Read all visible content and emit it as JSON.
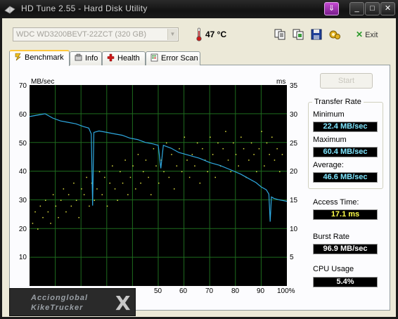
{
  "window": {
    "title": "HD Tune 2.55 - Hard Disk Utility",
    "buttons": {
      "extra": "⇓",
      "minimize": "_",
      "maximize": "□",
      "close": "✕"
    }
  },
  "toolbar": {
    "drive": "WDC WD3200BEVT-22ZCT (320 GB)",
    "temperature": "47 °C",
    "exit_label": "Exit",
    "tools": [
      "copy-text-icon",
      "copy-image-icon",
      "save-icon",
      "options-icon"
    ]
  },
  "tabs": [
    {
      "label": "Benchmark",
      "icon": "benchmark-icon",
      "active": true
    },
    {
      "label": "Info",
      "icon": "info-icon",
      "active": false
    },
    {
      "label": "Health",
      "icon": "health-icon",
      "active": false
    },
    {
      "label": "Error Scan",
      "icon": "error-scan-icon",
      "active": false
    }
  ],
  "benchmark": {
    "start_label": "Start",
    "transfer_rate_title": "Transfer Rate",
    "minimum_label": "Minimum",
    "minimum_value": "22.4 MB/sec",
    "maximum_label": "Maximum",
    "maximum_value": "60.4 MB/sec",
    "average_label": "Average:",
    "average_value": "46.6 MB/sec",
    "access_label": "Access Time:",
    "access_value": "17.1 ms",
    "burst_label": "Burst Rate",
    "burst_value": "96.9 MB/sec",
    "cpu_label": "CPU Usage",
    "cpu_value": "5.4%"
  },
  "watermark": {
    "line1": "Accionglobal",
    "line2": "KikeTrucker",
    "mark": "X"
  },
  "colors": {
    "transfer_line": "#2EA8E0",
    "access_dots": "#E0E040",
    "grid": "#1E6B1E",
    "chart_bg": "#000000"
  },
  "chart_data": {
    "type": "line",
    "xlabel": "",
    "ylabel": "MB/sec",
    "y2label": "ms",
    "xlim": [
      0,
      100
    ],
    "ylim": [
      0,
      70
    ],
    "y2lim": [
      0,
      35
    ],
    "x_ticks": [
      "50",
      "60",
      "70",
      "80",
      "90",
      "100%"
    ],
    "y_ticks": [
      "70",
      "60",
      "50",
      "40",
      "30",
      "20",
      "10"
    ],
    "y2_ticks": [
      "35",
      "30",
      "25",
      "20",
      "15",
      "10",
      "5"
    ],
    "grid": true,
    "series": [
      {
        "name": "Transfer Rate",
        "x": [
          0,
          3,
          6,
          9,
          12,
          15,
          18,
          21,
          23,
          24,
          24.5,
          25,
          27,
          30,
          33,
          36,
          39,
          42,
          45,
          48,
          50,
          51,
          52,
          55,
          58,
          62,
          66,
          70,
          74,
          78,
          82,
          85,
          88,
          90,
          92,
          93,
          93.5,
          94,
          95,
          97,
          100
        ],
        "y": [
          59,
          59.5,
          60,
          58.5,
          57.5,
          57,
          56.5,
          55.5,
          55,
          53,
          28,
          53.5,
          54,
          53.5,
          53,
          52.5,
          51.5,
          51,
          50,
          49.5,
          49,
          41,
          49,
          48,
          46.5,
          45.5,
          44.5,
          43,
          42,
          40.5,
          39,
          37.5,
          36,
          34.5,
          33.5,
          32,
          22.4,
          31,
          30.5,
          30,
          29.5
        ]
      },
      {
        "name": "Access Time",
        "x": [
          1,
          2,
          3,
          4,
          5,
          6,
          7,
          8,
          9,
          10,
          11,
          12,
          13,
          14,
          15,
          16,
          17,
          18,
          19,
          20,
          21,
          22,
          23,
          24,
          25,
          26,
          27,
          28,
          29,
          30,
          31,
          32,
          33,
          34,
          35,
          36,
          37,
          38,
          39,
          40,
          41,
          42,
          43,
          44,
          45,
          46,
          47,
          48,
          49,
          50,
          51,
          52,
          53,
          54,
          55,
          56,
          57,
          58,
          59,
          60,
          61,
          62,
          63,
          64,
          65,
          66,
          67,
          68,
          69,
          70,
          71,
          72,
          73,
          74,
          75,
          76,
          77,
          78,
          79,
          80,
          81,
          82,
          83,
          84,
          85,
          86,
          87,
          88,
          89,
          90,
          91,
          92,
          93,
          94,
          95,
          96,
          97,
          98
        ],
        "y": [
          11,
          13,
          10,
          14,
          12,
          15,
          13,
          11,
          16,
          14,
          12,
          15,
          17,
          13,
          16,
          14,
          18,
          15,
          12,
          17,
          16,
          19,
          14,
          18,
          15,
          17,
          20,
          16,
          19,
          14,
          18,
          21,
          17,
          15,
          20,
          18,
          22,
          16,
          19,
          21,
          17,
          23,
          18,
          20,
          22,
          19,
          16,
          24,
          21,
          18,
          22,
          20,
          25,
          19,
          23,
          17,
          21,
          24,
          20,
          26,
          22,
          19,
          23,
          21,
          25,
          18,
          24,
          22,
          20,
          26,
          23,
          19,
          25,
          21,
          24,
          27,
          22,
          20,
          25,
          23,
          21,
          26,
          24,
          19,
          22,
          25,
          23,
          20,
          24,
          27,
          21,
          25,
          23,
          26,
          22,
          24,
          20,
          23
        ]
      }
    ]
  }
}
